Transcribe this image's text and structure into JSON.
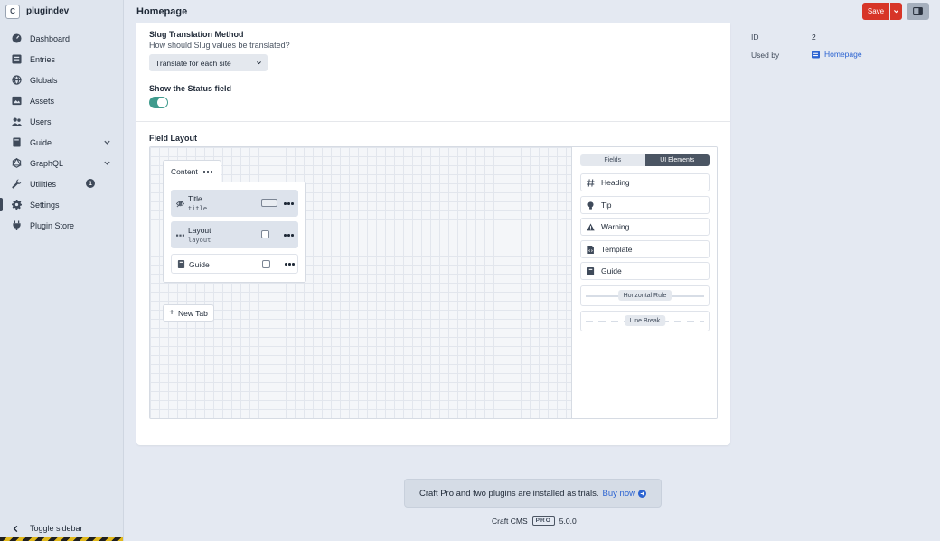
{
  "site": {
    "badge": "C",
    "name": "plugindev"
  },
  "nav": [
    {
      "label": "Dashboard",
      "icon": "dashboard-icon"
    },
    {
      "label": "Entries",
      "icon": "entries-icon"
    },
    {
      "label": "Globals",
      "icon": "globe-icon"
    },
    {
      "label": "Assets",
      "icon": "image-icon"
    },
    {
      "label": "Users",
      "icon": "users-icon"
    },
    {
      "label": "Guide",
      "icon": "book-icon"
    },
    {
      "label": "GraphQL",
      "icon": "graphql-icon"
    },
    {
      "label": "Utilities",
      "icon": "wrench-icon",
      "badge": "1"
    },
    {
      "label": "Settings",
      "icon": "gear-icon"
    },
    {
      "label": "Plugin Store",
      "icon": "plug-icon"
    }
  ],
  "toggle_sidebar": "Toggle sidebar",
  "header": {
    "title": "Homepage",
    "save_label": "Save"
  },
  "form": {
    "slug_label": "Slug Translation Method",
    "slug_help": "How should Slug values be translated?",
    "slug_value": "Translate for each site",
    "status_label": "Show the Status field",
    "status_on": true,
    "layout_label": "Field Layout"
  },
  "designer": {
    "tab_name": "Content",
    "fields": [
      {
        "name": "Title",
        "handle": "title"
      },
      {
        "name": "Layout",
        "handle": "layout"
      },
      {
        "name": "Guide",
        "handle": ""
      }
    ],
    "new_tab": "New Tab",
    "library_tabs": [
      "Fields",
      "UI Elements"
    ],
    "active_library_tab": "UI Elements",
    "ui_elements": [
      "Heading",
      "Tip",
      "Warning",
      "Template",
      "Guide",
      "Horizontal Rule",
      "Line Break"
    ]
  },
  "meta": {
    "id_label": "ID",
    "id_value": "2",
    "used_by_label": "Used by",
    "used_by_value": "Homepage"
  },
  "footer": {
    "notice": "Craft Pro and two plugins are installed as trials.",
    "buy_now": "Buy now",
    "product": "Craft CMS",
    "edition": "PRO",
    "version": "5.0.0"
  },
  "colors": {
    "save": "#d73528",
    "toggle": "#3f9b8d",
    "link": "#2b63d1"
  }
}
